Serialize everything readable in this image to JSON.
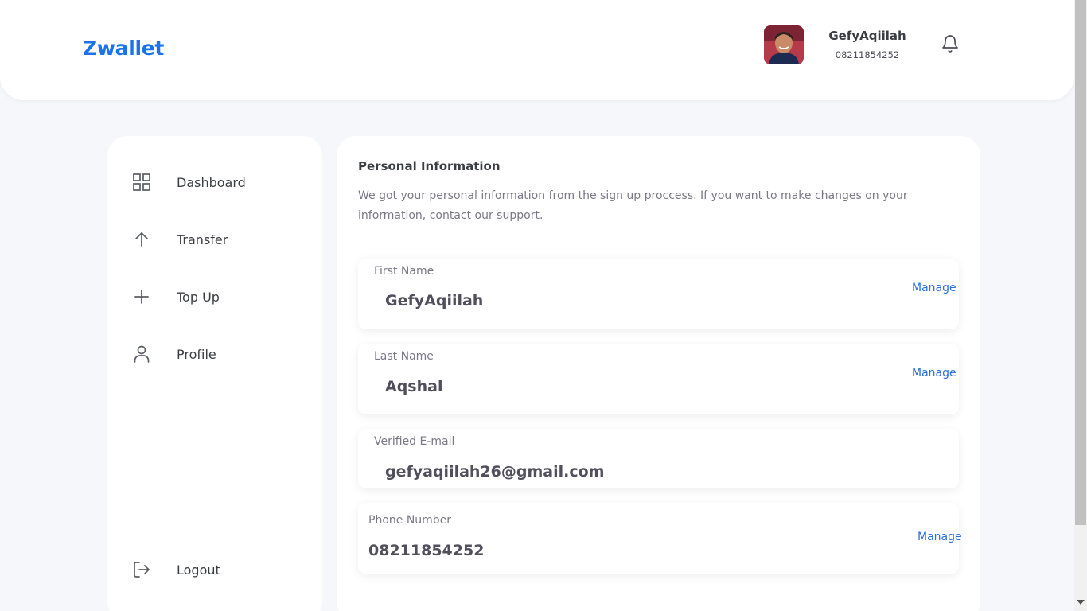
{
  "header": {
    "logo": "Zwallet",
    "user": {
      "name": "GefyAqiilah",
      "phone": "08211854252"
    },
    "icons": {
      "notification": "bell-icon"
    }
  },
  "sidebar": {
    "items": [
      {
        "label": "Dashboard",
        "icon": "grid-icon"
      },
      {
        "label": "Transfer",
        "icon": "arrow-up-icon"
      },
      {
        "label": "Top Up",
        "icon": "plus-icon"
      },
      {
        "label": "Profile",
        "icon": "user-icon"
      }
    ],
    "logout": {
      "label": "Logout",
      "icon": "logout-icon"
    }
  },
  "main": {
    "title": "Personal Information",
    "description": "We got your personal information from the sign up proccess. If you want to make changes on your information, contact our support.",
    "fields": [
      {
        "label": "First Name",
        "value": "GefyAqiilah",
        "action": "Manage"
      },
      {
        "label": "Last Name",
        "value": "Aqshal",
        "action": "Manage"
      },
      {
        "label": "Verified E-mail",
        "value": "gefyaqiilah26@gmail.com"
      },
      {
        "label": "Phone Number",
        "value": "08211854252",
        "action": "Manage"
      }
    ]
  },
  "colors": {
    "brand": "#1a73e8",
    "link": "#2a6fdb",
    "background": "#f5f7fb",
    "text": "#3a3d42"
  }
}
